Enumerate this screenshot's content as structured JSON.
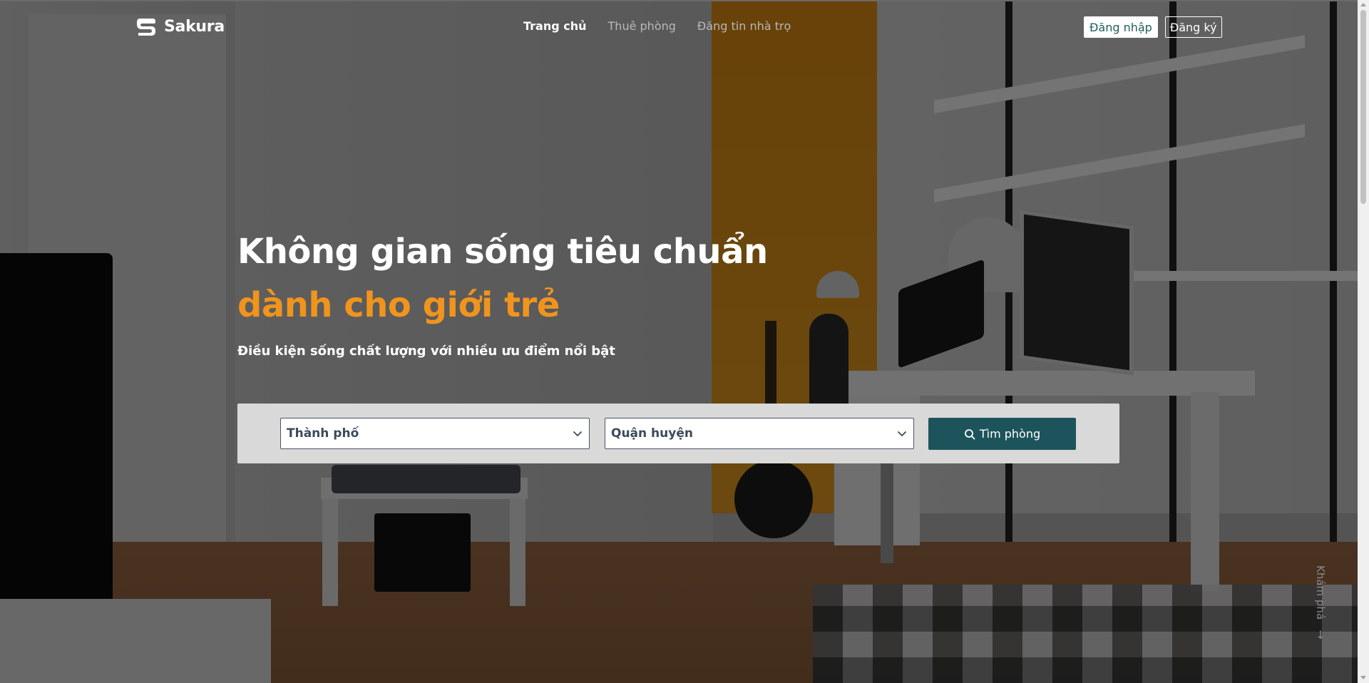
{
  "brand": {
    "name": "Sakura",
    "logo_icon": "sakura-s-logo"
  },
  "nav": {
    "items": [
      {
        "label": "Trang chủ",
        "active": true
      },
      {
        "label": "Thuê phòng",
        "active": false
      },
      {
        "label": "Đăng tin nhà trọ",
        "active": false
      }
    ]
  },
  "auth": {
    "login_label": "Đăng nhập",
    "register_label": "Đăng ký"
  },
  "hero": {
    "title": "Không gian sống tiêu chuẩn",
    "highlight": "dành cho giới trẻ",
    "subtitle": "Điều kiện sống chất lượng với nhiều ưu điểm nổi bật"
  },
  "search": {
    "city_value": "Thành phố",
    "district_value": "Quận huyện",
    "button_label": "Tìm phòng",
    "button_icon": "search-icon"
  },
  "explore": {
    "label": "Khám phá",
    "arrow": "↓"
  },
  "colors": {
    "accent_orange": "#f0941e",
    "button_teal": "#1d545b",
    "login_text": "#1f5f5b",
    "overlay": "rgba(0,0,0,0.52)"
  }
}
